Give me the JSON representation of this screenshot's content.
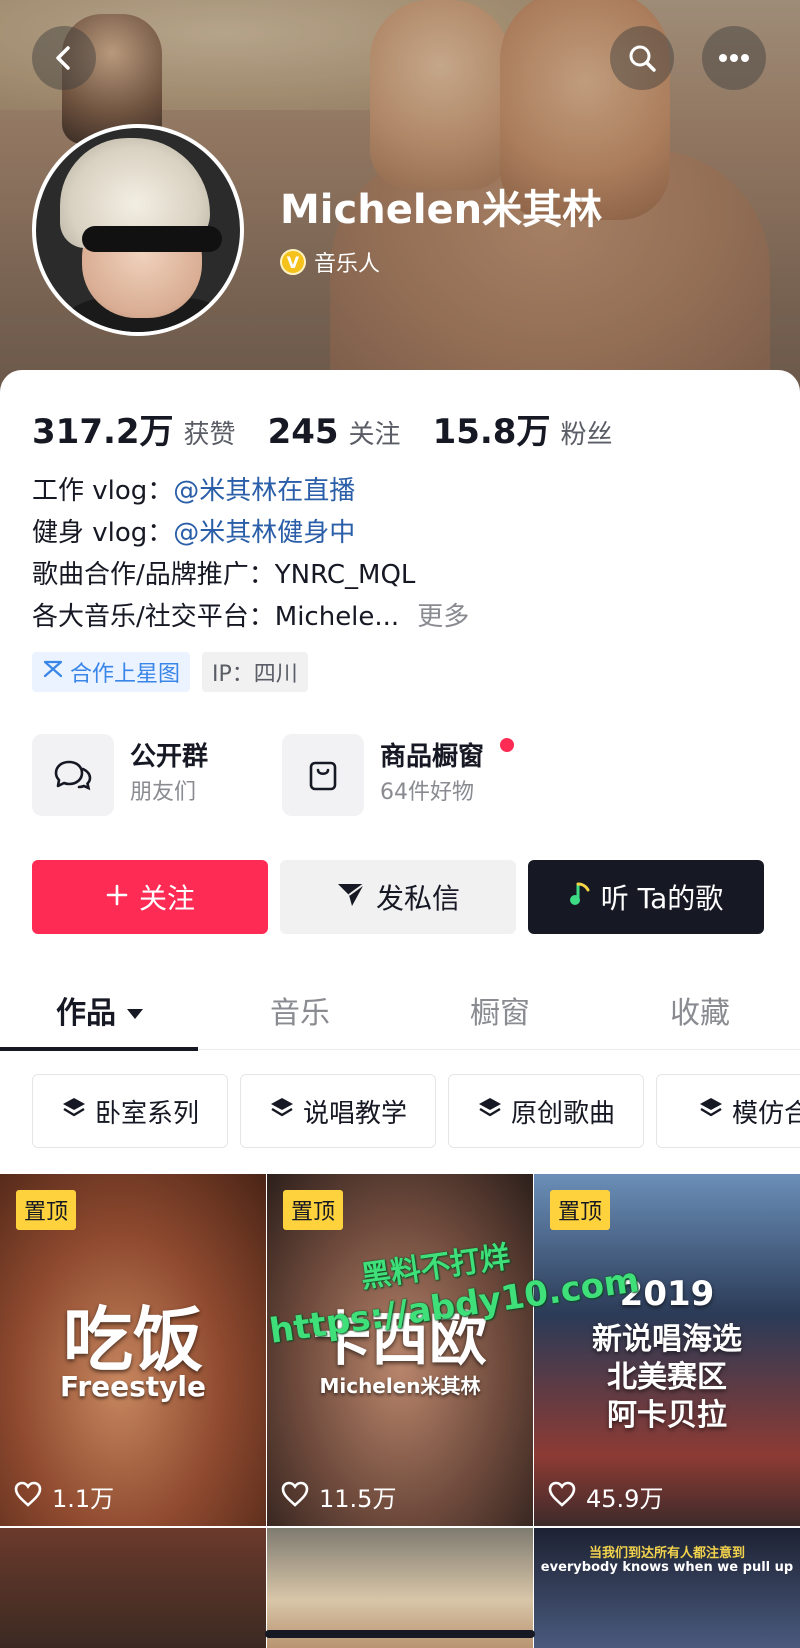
{
  "header": {
    "name": "Michelen米其林",
    "verified_label": "音乐人",
    "verified_badge": "V",
    "back_icon": "chevron-left-icon",
    "search_icon": "search-icon",
    "more_icon": "more-horizontal-icon"
  },
  "stats": [
    {
      "value": "317.2万",
      "label": "获赞"
    },
    {
      "value": "245",
      "label": "关注"
    },
    {
      "value": "15.8万",
      "label": "粉丝"
    }
  ],
  "bio": {
    "line1_prefix": "工作 vlog：",
    "line1_link": "@米其林在直播",
    "line2_prefix": "健身 vlog：",
    "line2_link": "@米其林健身中",
    "line3": "歌曲合作/品牌推广：YNRC_MQL",
    "line4": "各大音乐/社交平台：Michele...",
    "more": "更多"
  },
  "tags": {
    "star": "合作上星图",
    "ip": "IP：四川"
  },
  "quick_entries": {
    "group_title": "公开群",
    "group_sub": "朋友们",
    "shop_title": "商品橱窗",
    "shop_sub": "64件好物"
  },
  "actions": {
    "follow": "关注",
    "message": "发私信",
    "listen": "听 Ta的歌"
  },
  "tabs": [
    "作品",
    "音乐",
    "橱窗",
    "收藏"
  ],
  "collections": [
    "卧室系列",
    "说唱教学",
    "原创歌曲",
    "模仿合"
  ],
  "videos": [
    {
      "pinned": "置顶",
      "title": "吃饭",
      "subtitle": "Freestyle",
      "likes": "1.1万"
    },
    {
      "pinned": "置顶",
      "title": "卡西欧",
      "subtitle": "Michelen米其林",
      "likes": "11.5万"
    },
    {
      "pinned": "置顶",
      "title_line1": "2019",
      "title_line2": "新说唱海选",
      "title_line3": "北美赛区",
      "title_line4": "阿卡贝拉",
      "likes": "45.9万"
    }
  ],
  "second_row": {
    "caption_cn": "当我们到达所有人都注意到",
    "caption_en": "everybody knows when we pull up"
  },
  "watermark": {
    "line1": "黑料不打烊",
    "line2": "https://abdy10.com"
  },
  "colors": {
    "accent": "#fe2c55",
    "dark_button": "#161823",
    "link": "#2a5ea8",
    "pin_badge": "#fdd23c",
    "watermark": "#3fe07a"
  }
}
